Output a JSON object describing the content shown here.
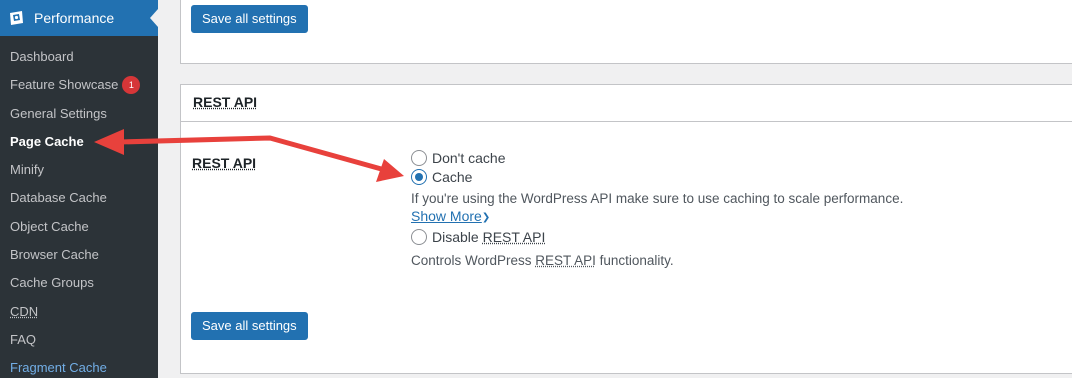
{
  "sidebar": {
    "title": "Performance",
    "items": [
      {
        "label": "Dashboard"
      },
      {
        "label": "Feature Showcase",
        "badge": "1"
      },
      {
        "label": "General Settings"
      },
      {
        "label": "Page Cache",
        "current": true
      },
      {
        "label": "Minify"
      },
      {
        "label": "Database Cache"
      },
      {
        "label": "Object Cache"
      },
      {
        "label": "Browser Cache"
      },
      {
        "label": "Cache Groups"
      },
      {
        "label": "CDN"
      },
      {
        "label": "FAQ"
      },
      {
        "label": "Fragment Cache"
      }
    ]
  },
  "top_box": {
    "save_label": "Save all settings"
  },
  "rest_box": {
    "heading": "REST API",
    "row_label": "REST API",
    "options": {
      "dont_cache": "Don't cache",
      "cache": "Cache",
      "cache_desc": "If you're using the WordPress API make sure to use caching to scale performance.",
      "show_more": "Show More",
      "disable_prefix": "Disable ",
      "disable_abbr": "REST API",
      "disable_desc_prefix": "Controls WordPress ",
      "disable_desc_abbr": "REST API",
      "disable_desc_suffix": " functionality."
    },
    "selected_option": "Cache",
    "save_label": "Save all settings"
  },
  "annotation": {
    "arrow_color": "#e8413c"
  },
  "colors": {
    "sidebar_bg": "#2c3338",
    "accent": "#2271b1",
    "badge": "#d63638"
  }
}
